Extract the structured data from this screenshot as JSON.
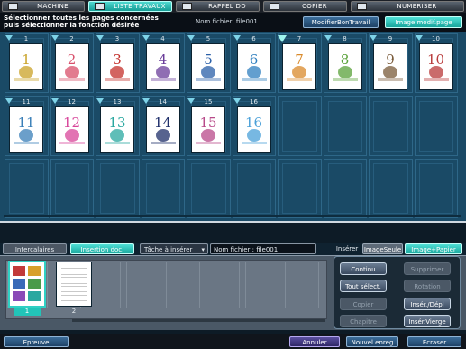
{
  "top_tabs": [
    {
      "label": "MACHINE",
      "icon": "copier-machine-icon"
    },
    {
      "label": "LISTE TRAVAUX",
      "icon": "job-list-icon"
    },
    {
      "label": "RAPPEL DD",
      "icon": "hard-disk-recall-icon"
    },
    {
      "label": "COPIER",
      "icon": "copy-icon"
    },
    {
      "label": "NUMERISER",
      "icon": "scan-icon"
    }
  ],
  "header": {
    "instruction_line1": "Sélectionner toutes les pages concernées",
    "instruction_line2": "puis sélectionner la fonction désirée",
    "file_name": "Nom fichier: file001",
    "modify_job_button": "ModifierBonTravail",
    "image_modify_button": "Image modif.page"
  },
  "pages_row1": [
    "1",
    "2",
    "3",
    "4",
    "5",
    "6",
    "7",
    "8",
    "9",
    "10"
  ],
  "pages_row2": [
    "11",
    "12",
    "13",
    "14",
    "15",
    "16"
  ],
  "selected_page": "7",
  "bottom": {
    "tab_intercalaires": "Intercalaires",
    "tab_insertion": "Insertion doc.",
    "task_to_insert": "Tâche à insérer",
    "file_name": "Nom fichier : file001",
    "insert_label": "Insérer",
    "image_only": "ImageSeule",
    "image_plus_paper": "Image+Papier",
    "doc_pages": [
      "1",
      "2"
    ]
  },
  "right_panel": {
    "continu": "Continu",
    "supprimer": "Supprimer",
    "tout_select": "Tout sélect.",
    "rotation": "Rotation",
    "copier": "Copier",
    "inser_depl": "Insér./Dépl",
    "chapitre": "Chapitre",
    "inser_vierge": "Insér.Vierge"
  },
  "footer": {
    "epreuve": "Epreuve",
    "annuler": "Annuler",
    "nouvel_enreg": "Nouvel enreg",
    "ecraser": "Ecraser"
  },
  "colors": {
    "accent_teal": "#22c4b8",
    "page_area_bg": "#1a4a66"
  }
}
